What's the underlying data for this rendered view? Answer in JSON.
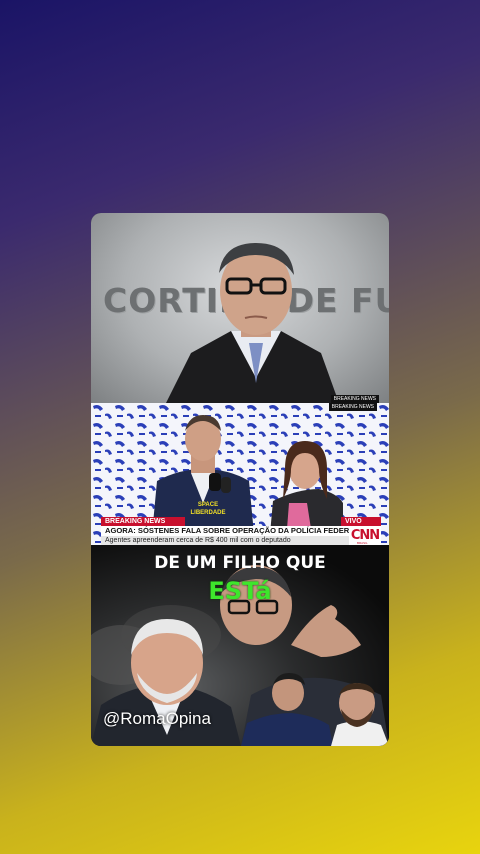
{
  "panel1": {
    "title": "CORTINA DE FUMAÇA",
    "badge": "BREAKING NEWS"
  },
  "panel2": {
    "top_badge": "BREAKING NEWS",
    "logo_text": "SPACE LIBERDADE",
    "breaking_label": "BREAKING NEWS",
    "live_label": "VIVO",
    "headline": "AGORA: SÓSTENES FALA SOBRE OPERAÇÃO DA POLÍCIA FEDERAL",
    "subline": "Agentes apreenderam cerca de R$ 400 mil com o deputado",
    "channel": "CNN",
    "channel_sub": "BRASIL"
  },
  "panel3": {
    "line1": "DE UM FILHO QUE",
    "line2_caps": "EST",
    "line2_lower": "á",
    "handle": "@RomaOpina"
  },
  "colors": {
    "bg_top": "#1a1466",
    "bg_bottom": "#e8d40e",
    "accent_green": "#3ee62c",
    "cnn_red": "#c8102e"
  }
}
